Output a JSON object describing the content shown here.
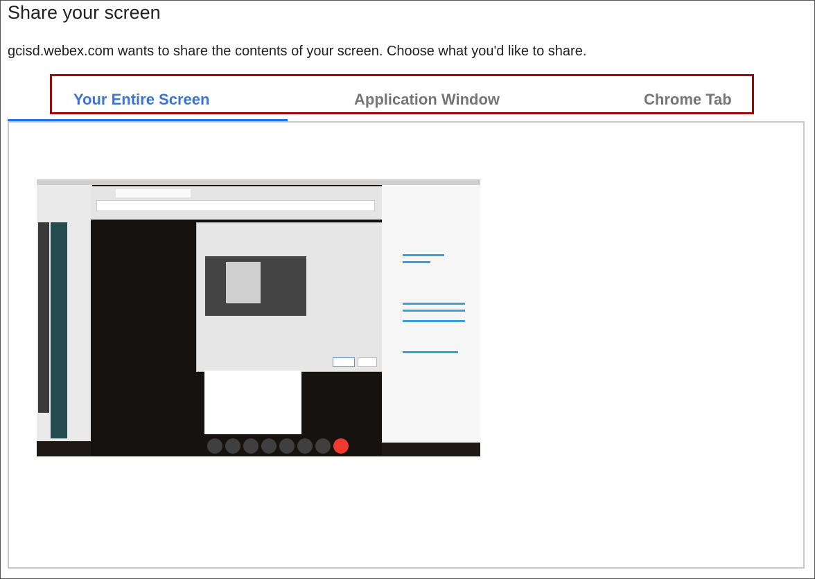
{
  "dialog": {
    "title": "Share your screen",
    "subtitle": "gcisd.webex.com wants to share the contents of your screen. Choose what you'd like to share."
  },
  "tabs": [
    {
      "label": "Your Entire Screen",
      "active": true
    },
    {
      "label": "Application Window",
      "active": false
    },
    {
      "label": "Chrome Tab",
      "active": false
    }
  ],
  "colors": {
    "active_tab": "#3d74cf",
    "inactive_tab": "#757575",
    "underline": "#1a73e8",
    "highlight_box": "#9b0b0b"
  },
  "preview": {
    "icon": "screen-thumbnail"
  }
}
